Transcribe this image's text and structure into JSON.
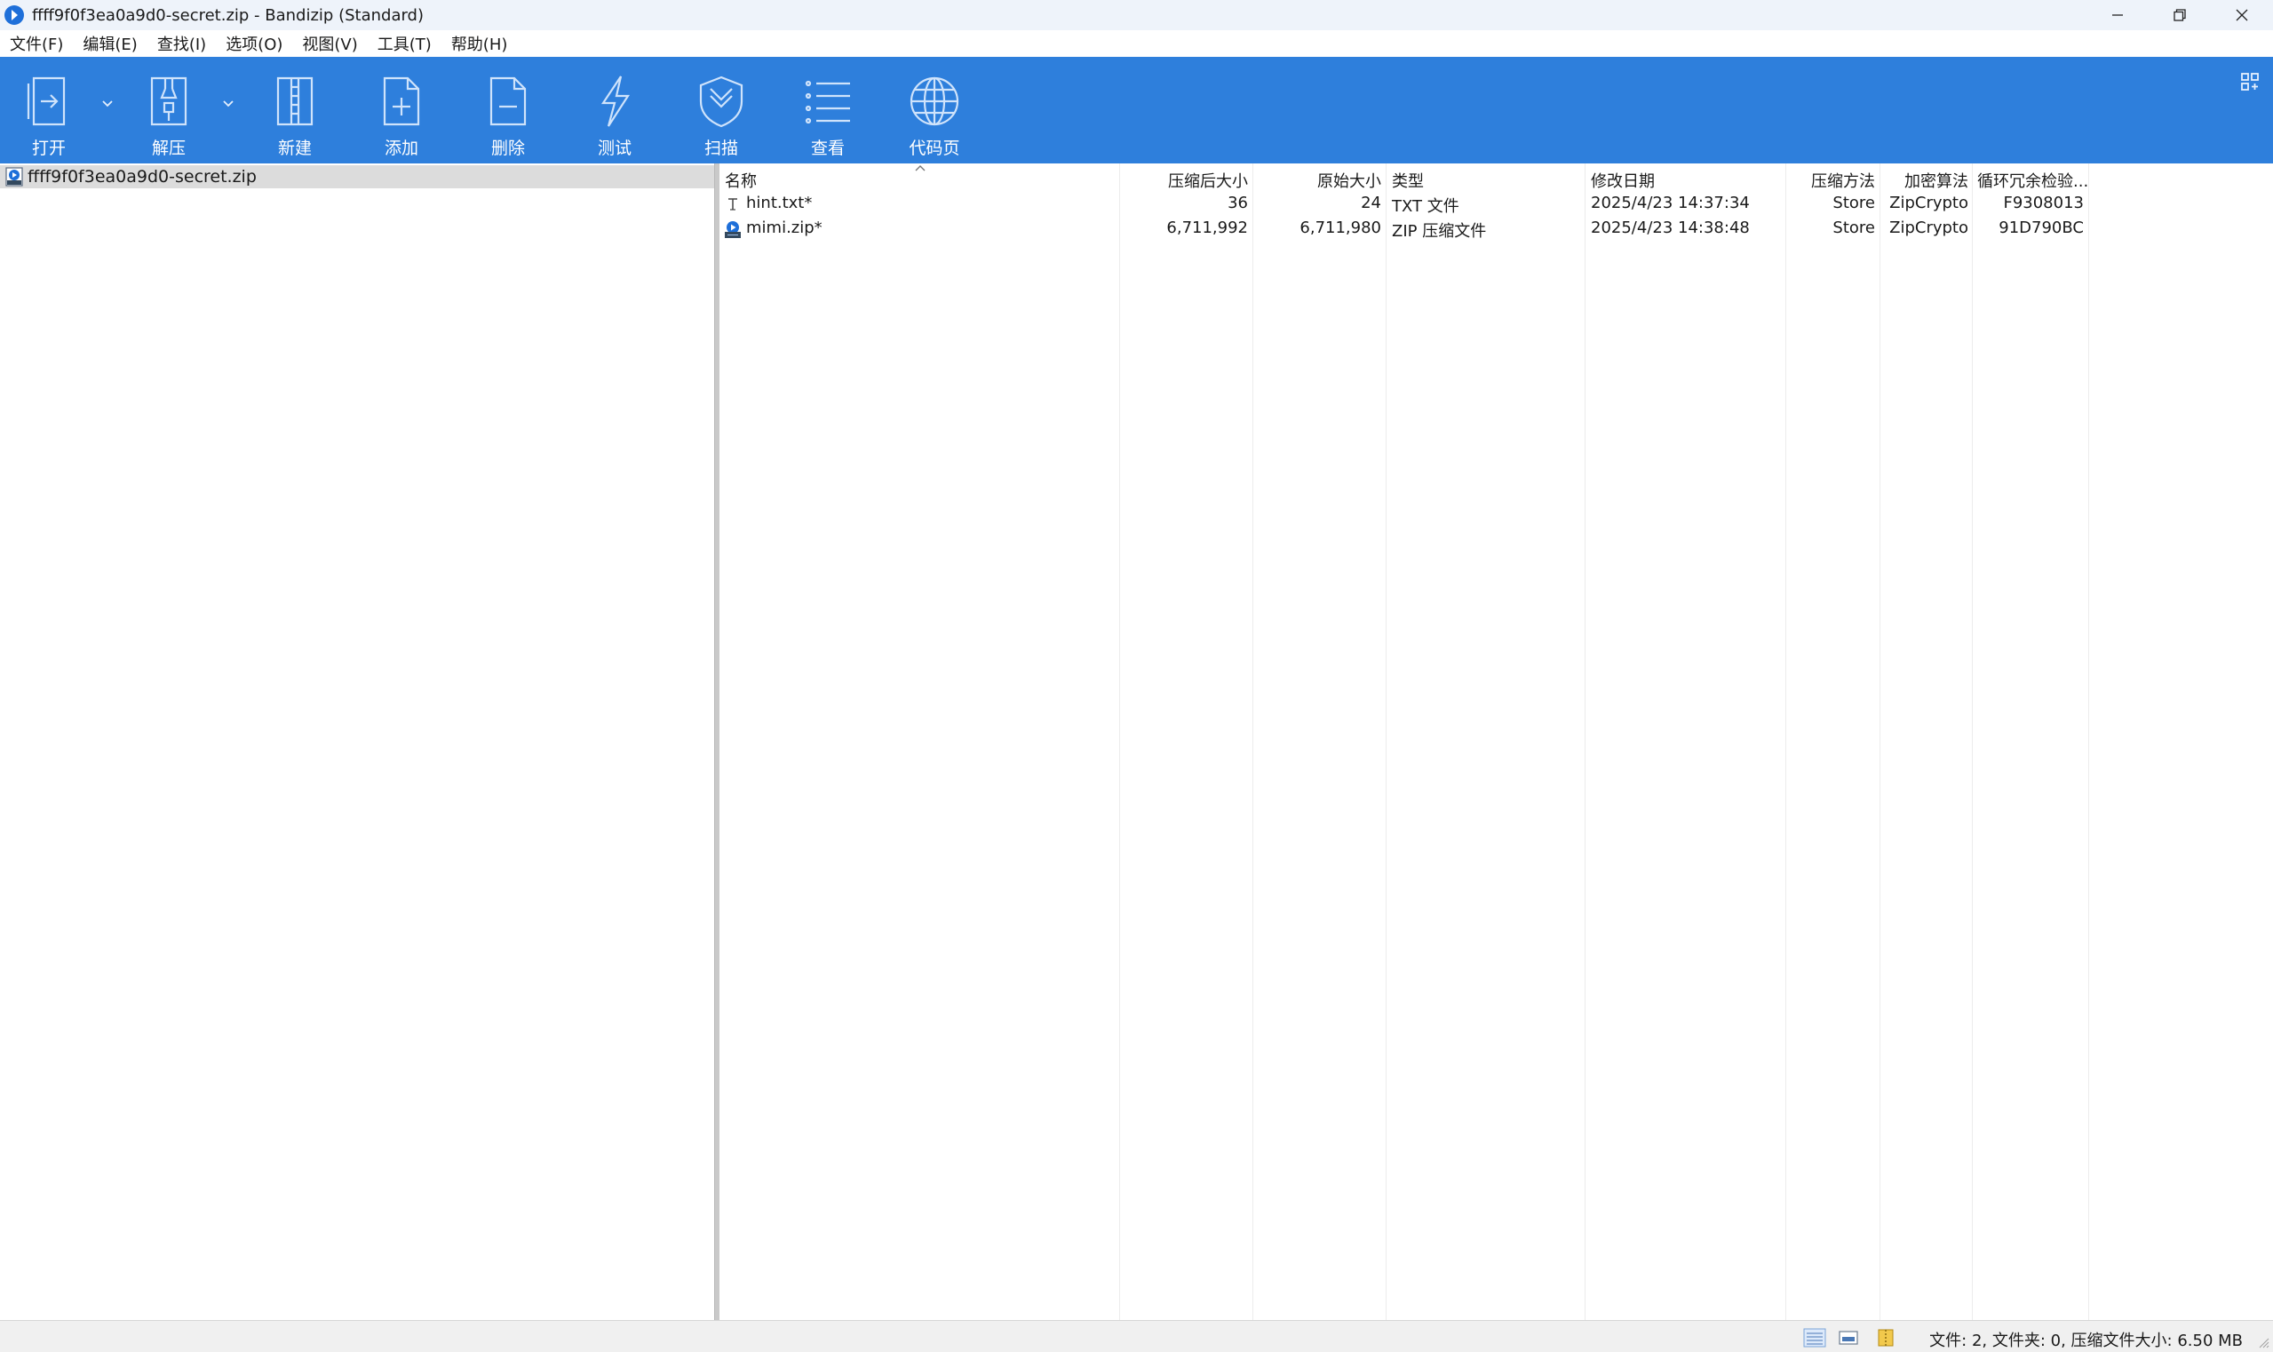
{
  "window": {
    "title": "ffff9f0f3ea0a9d0-secret.zip - Bandizip (Standard)",
    "accent_color": "#2e7fdc"
  },
  "menu": [
    "文件(F)",
    "编辑(E)",
    "查找(I)",
    "选项(O)",
    "视图(V)",
    "工具(T)",
    "帮助(H)"
  ],
  "toolbar": {
    "buttons": [
      {
        "label": "打开",
        "icon": "open-icon",
        "has_dropdown": true
      },
      {
        "label": "解压",
        "icon": "extract-icon",
        "has_dropdown": true
      },
      {
        "label": "新建",
        "icon": "new-archive-icon",
        "has_dropdown": false
      },
      {
        "label": "添加",
        "icon": "add-file-icon",
        "has_dropdown": false
      },
      {
        "label": "删除",
        "icon": "delete-file-icon",
        "has_dropdown": false
      },
      {
        "label": "测试",
        "icon": "test-lightning-icon",
        "has_dropdown": false
      },
      {
        "label": "扫描",
        "icon": "scan-shield-icon",
        "has_dropdown": false
      },
      {
        "label": "查看",
        "icon": "view-list-icon",
        "has_dropdown": false
      },
      {
        "label": "代码页",
        "icon": "globe-icon",
        "has_dropdown": false
      }
    ]
  },
  "tree": {
    "root": "ffff9f0f3ea0a9d0-secret.zip"
  },
  "list": {
    "columns": [
      "名称",
      "压缩后大小",
      "原始大小",
      "类型",
      "修改日期",
      "压缩方法",
      "加密算法",
      "循环冗余检验..."
    ],
    "rows": [
      {
        "name": "hint.txt*",
        "packed": "36",
        "size": "24",
        "type": "TXT 文件",
        "modified": "2025/4/23 14:37:34",
        "method": "Store",
        "encryption": "ZipCrypto",
        "crc": "F9308013",
        "icon": "text-file-icon"
      },
      {
        "name": "mimi.zip*",
        "packed": "6,711,992",
        "size": "6,711,980",
        "type": "ZIP 压缩文件",
        "modified": "2025/4/23 14:38:48",
        "method": "Store",
        "encryption": "ZipCrypto",
        "crc": "91D790BC",
        "icon": "zip-file-icon"
      }
    ]
  },
  "status": {
    "text": "文件: 2, 文件夹: 0, 压缩文件大小: 6.50 MB"
  }
}
